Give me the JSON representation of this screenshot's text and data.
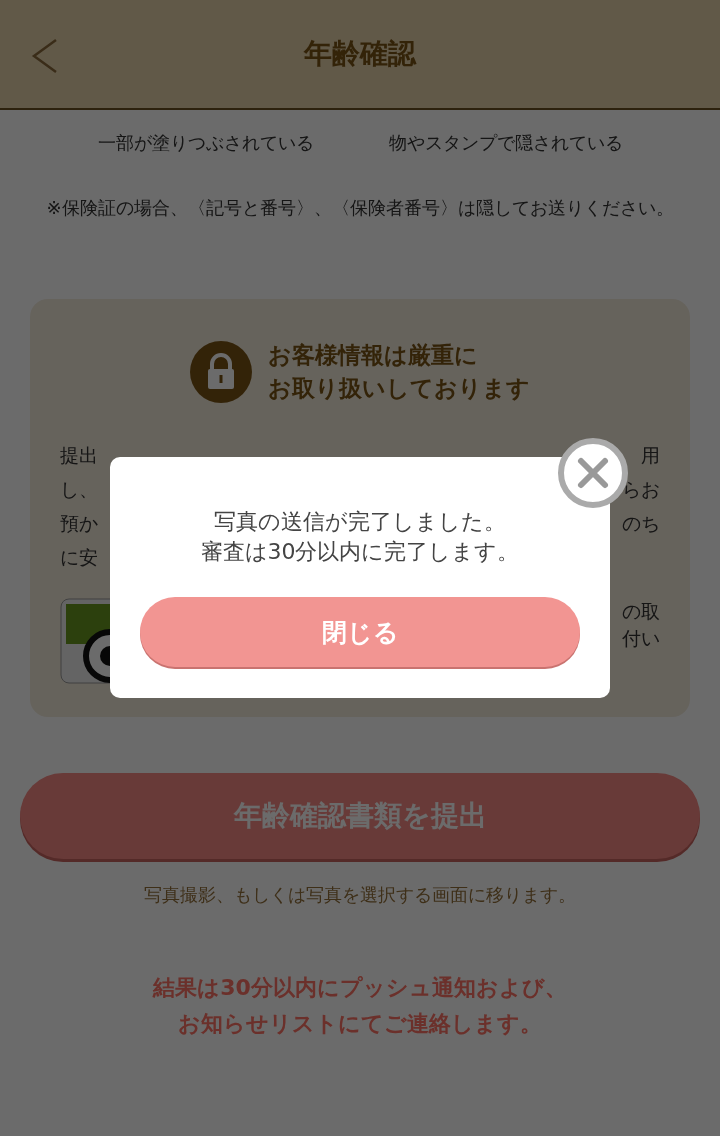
{
  "header": {
    "title": "年齢確認"
  },
  "examples": [
    "一部が塗りつぶされている",
    "物やスタンプで隠されている"
  ],
  "note": "※保険証の場合、〈記号と番号〉、〈保険者番号〉は隠してお送りください。",
  "security_card": {
    "heading_lines": [
      "お客様情報は厳重に",
      "お取り扱いしております"
    ],
    "body_left": [
      "提出",
      "し、",
      "預か",
      "に安"
    ],
    "body_right": [
      "用",
      "らお",
      "のち"
    ],
    "seal_text": [
      "の取",
      "付い"
    ]
  },
  "submit_button": "年齢確認書類を提出",
  "submit_hint": "写真撮影、もしくは写真を選択する画面に移ります。",
  "result_notice_lines": [
    "結果は30分以内にプッシュ通知および、",
    "お知らせリストにてご連絡します。"
  ],
  "dialog": {
    "message_lines": [
      "写真の送信が完了しました。",
      "審査は30分以内に完了します。"
    ],
    "close_button": "閉じる"
  }
}
